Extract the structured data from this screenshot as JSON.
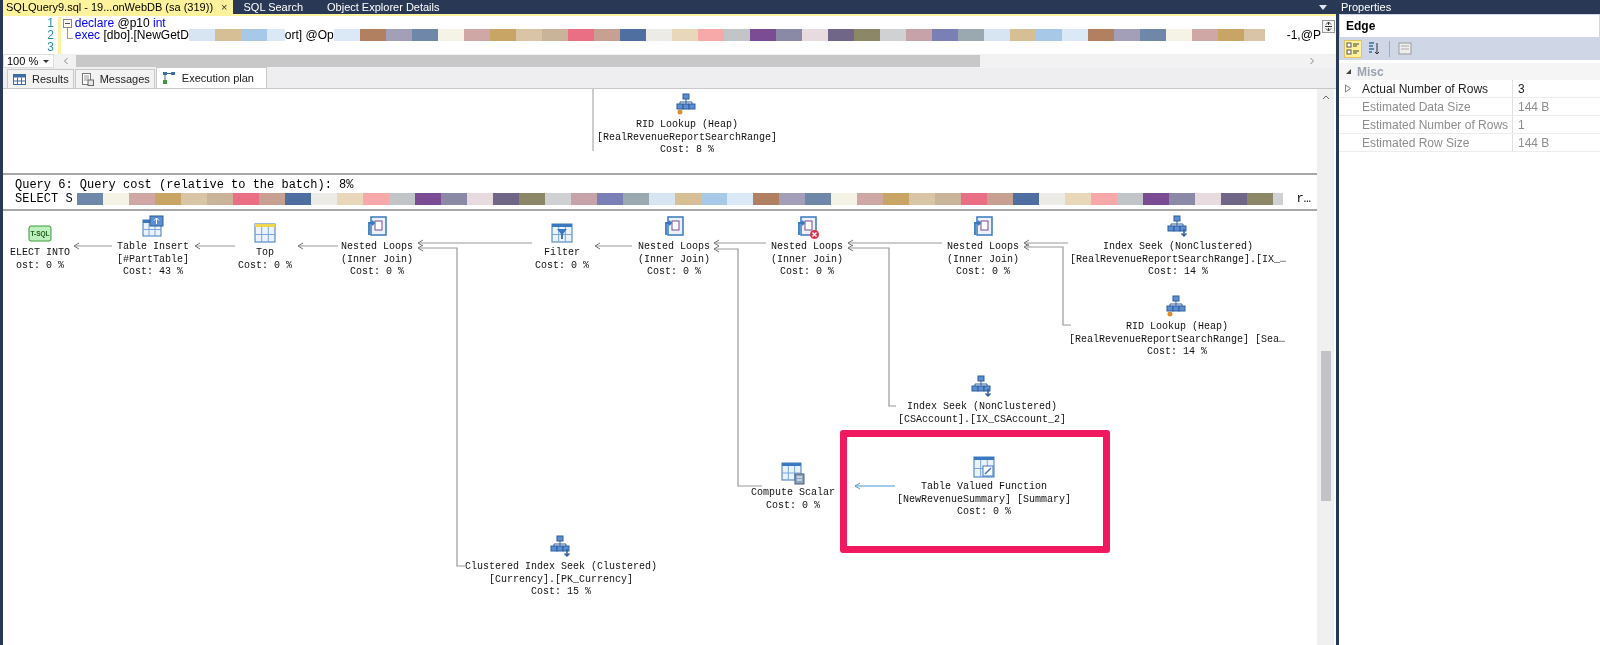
{
  "document_tabs": [
    {
      "label": "SQLQuery9.sql - 19...onWebDB (sa (319))",
      "selected": true,
      "close": "×"
    },
    {
      "label": "SQL Search",
      "selected": false
    },
    {
      "label": "Object Explorer Details",
      "selected": false
    }
  ],
  "editor": {
    "lines": [
      {
        "number": "1",
        "foldable": true,
        "segments": [
          {
            "kind": "keyword",
            "text": "declare"
          },
          {
            "kind": "text",
            "text": " @p10 "
          },
          {
            "kind": "keyword",
            "text": "int"
          }
        ]
      },
      {
        "number": "2",
        "foldable": false,
        "segments": [
          {
            "kind": "keyword",
            "text": "exec"
          },
          {
            "kind": "text",
            "text": " [dbo].[NewGetD"
          },
          {
            "kind": "redacted"
          },
          {
            "kind": "text",
            "text": "ort] @Op"
          },
          {
            "kind": "redacted"
          },
          {
            "kind": "text",
            "text": "-1,@P"
          }
        ]
      },
      {
        "number": "3",
        "foldable": false
      }
    ],
    "zoom": "100 %"
  },
  "result_tabs": [
    {
      "label": "Results",
      "selected": false
    },
    {
      "label": "Messages",
      "selected": false
    },
    {
      "label": "Execution plan",
      "selected": true
    }
  ],
  "plan": {
    "previous_plan_node": {
      "kind": "rid-lookup",
      "lines": [
        "RID Lookup (Heap)",
        "[RealRevenueReportSearchRange]",
        "Cost: 8 %"
      ]
    },
    "query_header": "Query 6: Query cost (relative to the batch): 8%",
    "statement": {
      "start": "SELECT S",
      "end": "r…"
    },
    "nodes": [
      {
        "kind": "tsql",
        "icon_text": "T-SQL",
        "lines": [
          "ELECT INTO",
          "ost: 0 %"
        ],
        "warning": false,
        "highlighted": false
      },
      {
        "kind": "table-insert",
        "lines": [
          "Table Insert",
          "[#PartTable]",
          "Cost: 43 %"
        ],
        "warning": false,
        "highlighted": false
      },
      {
        "kind": "top",
        "lines": [
          "Top",
          "Cost: 0 %"
        ],
        "warning": false,
        "highlighted": false
      },
      {
        "kind": "nested-loops",
        "lines": [
          "Nested Loops",
          "(Inner Join)",
          "Cost: 0 %"
        ],
        "warning": false,
        "highlighted": false
      },
      {
        "kind": "filter",
        "lines": [
          "Filter",
          "Cost: 0 %"
        ],
        "warning": false,
        "highlighted": false
      },
      {
        "kind": "nested-loops",
        "lines": [
          "Nested Loops",
          "(Inner Join)",
          "Cost: 0 %"
        ],
        "warning": false,
        "highlighted": false
      },
      {
        "kind": "nested-loops",
        "lines": [
          "Nested Loops",
          "(Inner Join)",
          "Cost: 0 %"
        ],
        "warning": true,
        "highlighted": false
      },
      {
        "kind": "nested-loops",
        "lines": [
          "Nested Loops",
          "(Inner Join)",
          "Cost: 0 %"
        ],
        "warning": false,
        "highlighted": false
      },
      {
        "kind": "index-seek",
        "lines": [
          "Index Seek (NonClustered)",
          "[RealRevenueReportSearchRange].[IX_…",
          "Cost: 14 %"
        ],
        "warning": false,
        "highlighted": false
      },
      {
        "kind": "rid-lookup",
        "lines": [
          "RID Lookup (Heap)",
          "[RealRevenueReportSearchRange] [Sea…",
          "Cost: 14 %"
        ],
        "warning": false,
        "highlighted": false
      },
      {
        "kind": "index-seek",
        "lines": [
          "Index Seek (NonClustered)",
          "[CSAccount].[IX_CSAccount_2]"
        ],
        "warning": false,
        "highlighted": false
      },
      {
        "kind": "compute-scalar",
        "lines": [
          "Compute Scalar",
          "Cost: 0 %"
        ],
        "warning": false,
        "highlighted": false
      },
      {
        "kind": "table-valued-function",
        "lines": [
          "Table Valued Function",
          "[NewRevenueSummary] [Summary]",
          "Cost: 0 %"
        ],
        "warning": false,
        "highlighted": true
      },
      {
        "kind": "index-seek",
        "lines": [
          "Clustered Index Seek (Clustered)",
          "[Currency].[PK_Currency]",
          "Cost: 15 %"
        ],
        "warning": false,
        "highlighted": false
      }
    ]
  },
  "properties": {
    "title": "Properties",
    "object": "Edge",
    "toolbar": [
      {
        "kind": "categorized",
        "selected": true
      },
      {
        "kind": "alphabetical",
        "selected": false
      },
      {
        "kind": "property-pages",
        "selected": false
      }
    ],
    "category": "Misc",
    "rows": [
      {
        "name": "Actual Number of Rows",
        "value": "3",
        "expandable": true,
        "readonly": false
      },
      {
        "name": "Estimated Data Size",
        "value": "144 B",
        "expandable": false,
        "readonly": true
      },
      {
        "name": "Estimated Number of Rows",
        "value": "1",
        "expandable": false,
        "readonly": true
      },
      {
        "name": "Estimated Row Size",
        "value": "144 B",
        "expandable": false,
        "readonly": true
      }
    ]
  }
}
